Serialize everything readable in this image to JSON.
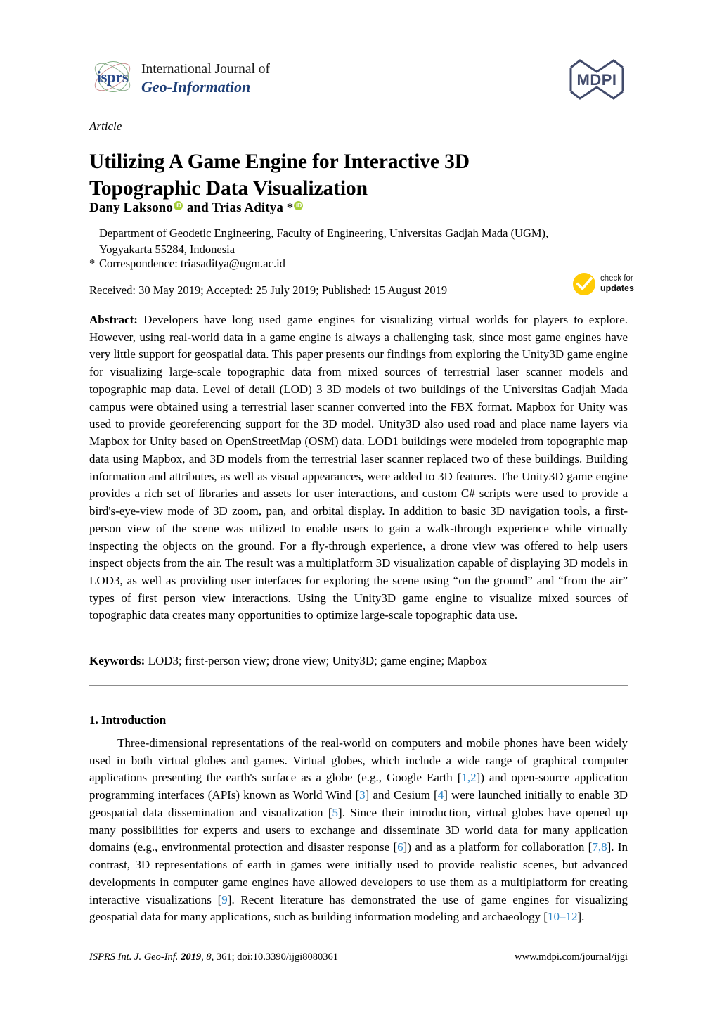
{
  "masthead": {
    "isprs_wordmark": "isprs",
    "journal_line1": "International Journal of",
    "journal_line2": "Geo-Information",
    "publisher_logo": "MDPI"
  },
  "article": {
    "kind": "Article",
    "title": "Utilizing A Game Engine for Interactive 3D Topographic Data Visualization",
    "authors_pre": "Dany Laksono",
    "authors_mid": "and Trias Aditya *",
    "orcid_label": "iD",
    "affiliation": "Department of Geodetic Engineering, Faculty of Engineering, Universitas Gadjah Mada (UGM), Yogyakarta 55284, Indonesia",
    "correspondence_marker": "*",
    "correspondence": "Correspondence: triasaditya@ugm.ac.id",
    "dates": "Received: 30 May 2019; Accepted: 25 July 2019; Published: 15 August 2019"
  },
  "crossmark": {
    "line1": "check for",
    "line2": "updates",
    "color": "#FFCB05"
  },
  "abstract": {
    "label": "Abstract:",
    "text": "Developers have long used game engines for visualizing virtual worlds for players to explore. However, using real-world data in a game engine is always a challenging task, since most game engines have very little support for geospatial data. This paper presents our findings from exploring the Unity3D game engine for visualizing large-scale topographic data from mixed sources of terrestrial laser scanner models and topographic map data. Level of detail (LOD) 3 3D models of two buildings of the Universitas Gadjah Mada campus were obtained using a terrestrial laser scanner converted into the FBX format. Mapbox for Unity was used to provide georeferencing support for the 3D model. Unity3D also used road and place name layers via Mapbox for Unity based on OpenStreetMap (OSM) data. LOD1 buildings were modeled from topographic map data using Mapbox, and 3D models from the terrestrial laser scanner replaced two of these buildings. Building information and attributes, as well as visual appearances, were added to 3D features. The Unity3D game engine provides a rich set of libraries and assets for user interactions, and custom C# scripts were used to provide a bird's-eye-view mode of 3D zoom, pan, and orbital display. In addition to basic 3D navigation tools, a first-person view of the scene was utilized to enable users to gain a walk-through experience while virtually inspecting the objects on the ground. For a fly-through experience, a drone view was offered to help users inspect objects from the air. The result was a multiplatform 3D visualization capable of displaying 3D models in LOD3, as well as providing user interfaces for exploring the scene using “on the ground” and “from the air” types of first person view interactions. Using the Unity3D game engine to visualize mixed sources of topographic data creates many opportunities to optimize large-scale topographic data use."
  },
  "keywords": {
    "label": "Keywords:",
    "text": "LOD3; first-person view; drone view; Unity3D; game engine; Mapbox"
  },
  "introduction": {
    "heading": "1. Introduction",
    "paragraph_part1": "Three-dimensional representations of the real-world on computers and mobile phones have been widely used in both virtual globes and games. Virtual globes, which include a wide range of graphical computer applications presenting the earth's surface as a globe (e.g., Google Earth [",
    "ref1": "1,2",
    "paragraph_part2": "]) and open-source application programming interfaces (APIs) known as World Wind [",
    "ref2": "3",
    "paragraph_part3": "] and Cesium [",
    "ref3": "4",
    "paragraph_part4": "] were launched initially to enable 3D geospatial data dissemination and visualization [",
    "ref4": "5",
    "paragraph_part5": "]. Since their introduction, virtual globes have opened up many possibilities for experts and users to exchange and disseminate 3D world data for many application domains (e.g., environmental protection and disaster response [",
    "ref5": "6",
    "paragraph_part6": "]) and as a platform for collaboration [",
    "ref6": "7,8",
    "paragraph_part7": "]. In contrast, 3D representations of earth in games were initially used to provide realistic scenes, but advanced developments in computer game engines have allowed developers to use them as a multiplatform for creating interactive visualizations [",
    "ref7": "9",
    "paragraph_part8": "]. Recent literature has demonstrated the use of game engines for visualizing geospatial data for many applications, such as building information modeling and archaeology [",
    "ref8": "10–12",
    "paragraph_part9": "]."
  },
  "footer": {
    "journal_abbrev": "ISPRS Int. J. Geo-Inf.",
    "year": "2019",
    "volume": "8",
    "article_no": "361",
    "doi": "doi:10.3390/ijgi8080361",
    "url": "www.mdpi.com/journal/ijgi"
  }
}
